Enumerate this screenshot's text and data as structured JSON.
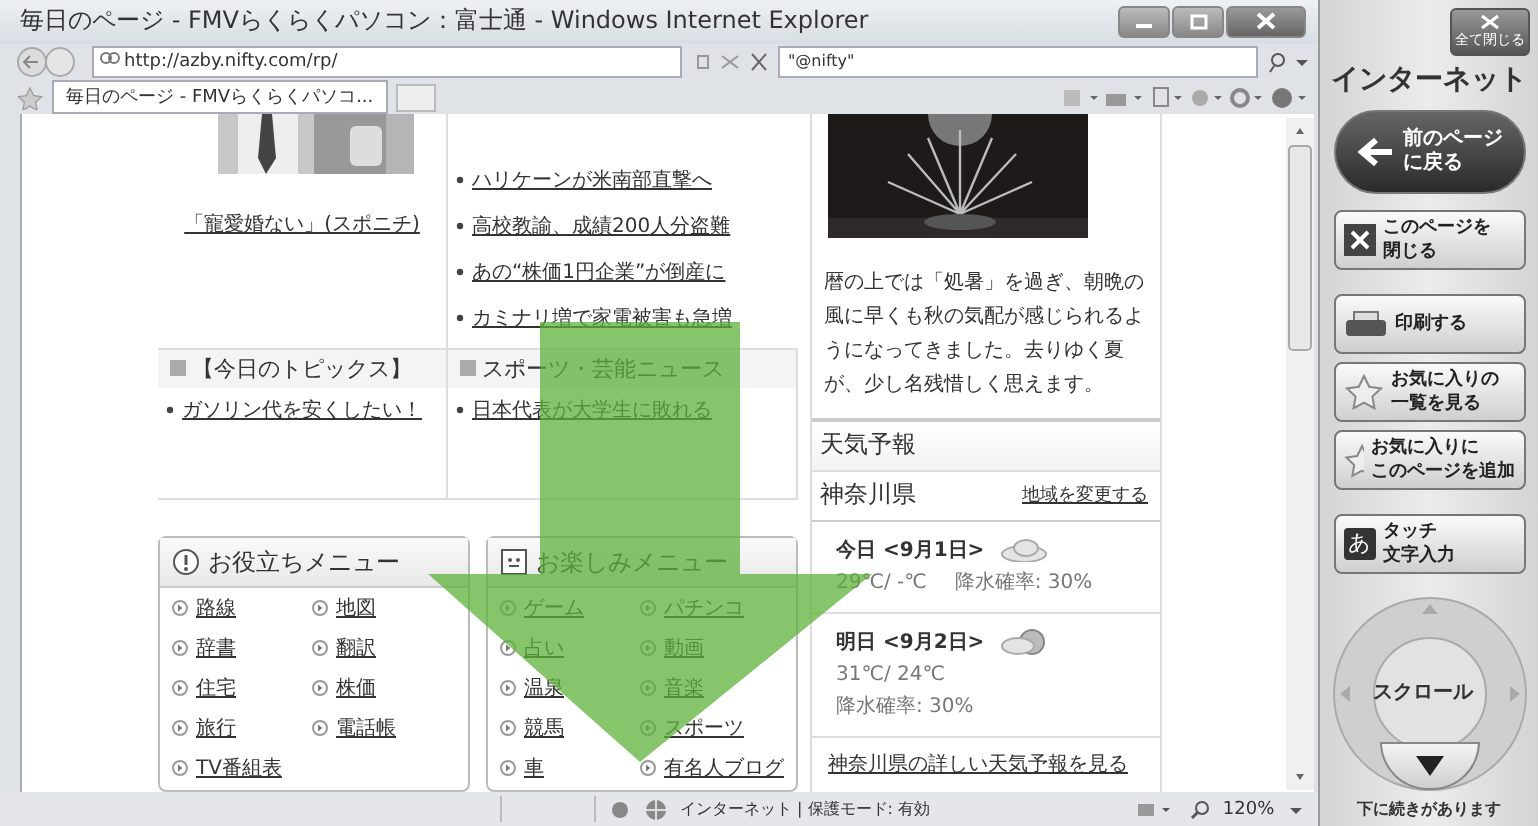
{
  "window": {
    "title": "毎日のページ - FMVらくらくパソコン：富士通 - Windows Internet Explorer"
  },
  "address_bar": {
    "url": "http://azby.nifty.com/rp/"
  },
  "search_box": {
    "value": "\"@nifty\""
  },
  "tabs": [
    {
      "label": "毎日のページ - FMVらくらくパソコ...",
      "selected": true
    }
  ],
  "page": {
    "photo_caption": "「寵愛婚ない」(スポニチ)",
    "news": [
      "ハリケーンが米南部直撃へ",
      "高校教諭、成績200人分盗難",
      "あの“株価1円企業”が倒産に",
      "カミナリ増で家電被害も急増"
    ],
    "sections": [
      {
        "title": "【今日のトピックス】",
        "items": [
          "ガソリン代を安くしたい！"
        ]
      },
      {
        "title": "スポーツ・芸能ニュース",
        "items": [
          "日本代表が大学生に敗れる"
        ]
      }
    ],
    "menus": [
      {
        "title": "お役立ちメニュー",
        "items": [
          "路線",
          "地図",
          "辞書",
          "翻訳",
          "住宅",
          "株価",
          "旅行",
          "電話帳",
          "TV番組表"
        ]
      },
      {
        "title": "お楽しみメニュー",
        "items": [
          "ゲーム",
          "パチンコ",
          "占い",
          "動画",
          "温泉",
          "音楽",
          "競馬",
          "スポーツ",
          "車",
          "有名人ブログ"
        ]
      }
    ],
    "essay": "暦の上では「処暑」を過ぎ、朝晩の風に早くも秋の気配が感じられるようになってきました。去りゆく夏が、少し名残惜しく思えます。",
    "weather": {
      "title": "天気予報",
      "region": "神奈川県",
      "change_link": "地域を変更する",
      "days": [
        {
          "label": "今日 <9月1日>",
          "kind": "cloud",
          "temps": "29℃/ -℃",
          "rain": "降水確率: 30%"
        },
        {
          "label": "明日 <9月2日>",
          "kind": "cloud_sun",
          "temps": "31℃/ 24℃",
          "rain": "降水確率: 30%"
        }
      ],
      "detail_link": "神奈川県の詳しい天気予報を見る"
    }
  },
  "status_bar": {
    "zone": "インターネット | 保護モード: 有効",
    "zoom": "120%"
  },
  "side_panel": {
    "close_all": "全て閉じる",
    "title": "インターネット",
    "buttons": [
      {
        "kind": "back",
        "lines": [
          "前のページ",
          "に戻る"
        ]
      },
      {
        "kind": "close",
        "lines": [
          "このページを",
          "閉じる"
        ]
      },
      {
        "kind": "print",
        "lines": [
          "印刷する"
        ]
      },
      {
        "kind": "favorites",
        "lines": [
          "お気に入りの",
          "一覧を見る"
        ]
      },
      {
        "kind": "add_favorite",
        "lines": [
          "お気に入りに",
          "このページを追加"
        ]
      },
      {
        "kind": "touch",
        "key": "あ",
        "lines": [
          "タッチ",
          "文字入力"
        ]
      }
    ],
    "scroll_label": "スクロール",
    "more_note": "下に続きがあります"
  }
}
